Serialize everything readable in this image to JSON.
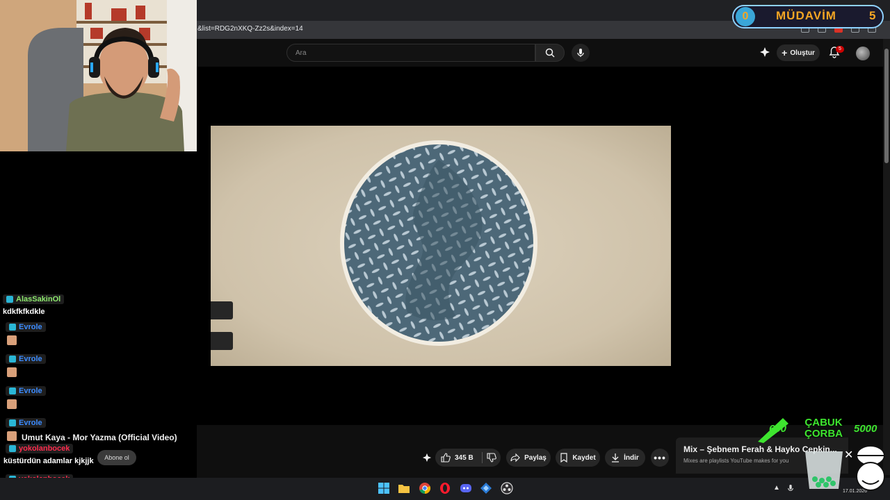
{
  "browser": {
    "url": "&list=RDG2nXKQ-Zz2s&index=14"
  },
  "youtube": {
    "search_placeholder": "Ara",
    "create_label": "Oluştur",
    "notification_count": "5"
  },
  "video": {
    "title": "Umut Kaya - Mor Yazma (Official Video)",
    "subscribe_label": "Abone ol",
    "like_count": "345 B",
    "share_label": "Paylaş",
    "save_label": "Kaydet",
    "download_label": "İndir"
  },
  "mix": {
    "title": "Mix – Şebnem Ferah & Hayko Cepkin...",
    "subtitle": "Mixes are playlists YouTube makes for you"
  },
  "chat": [
    {
      "user": "AlasSakinOl",
      "color": "#8de86d",
      "message": "kdkfkfkdkle",
      "emote": false
    },
    {
      "user": "Evrole",
      "color": "#3c8cff",
      "message": "",
      "emote": true
    },
    {
      "user": "Evrole",
      "color": "#3c8cff",
      "message": "",
      "emote": true
    },
    {
      "user": "Evrole",
      "color": "#3c8cff",
      "message": "",
      "emote": true
    },
    {
      "user": "Evrole",
      "color": "#3c8cff",
      "message": "",
      "emote": true
    },
    {
      "user": "yokolanbocek",
      "color": "#ff2b4d",
      "message": "küstürdün adamlar kjkjjk",
      "emote": false
    },
    {
      "user": "yokolanbocek",
      "color": "#ff2b4d",
      "message": "",
      "emote": true
    }
  ],
  "overlay": {
    "coin": "0",
    "badge_text": "MÜDAVİM",
    "badge_num": "5",
    "price_left": "600",
    "promo_line1": "ÇABUK",
    "promo_line2": "ÇORBA",
    "price_right": "5000"
  },
  "taskbar": {
    "clock": "17.01.2026"
  }
}
